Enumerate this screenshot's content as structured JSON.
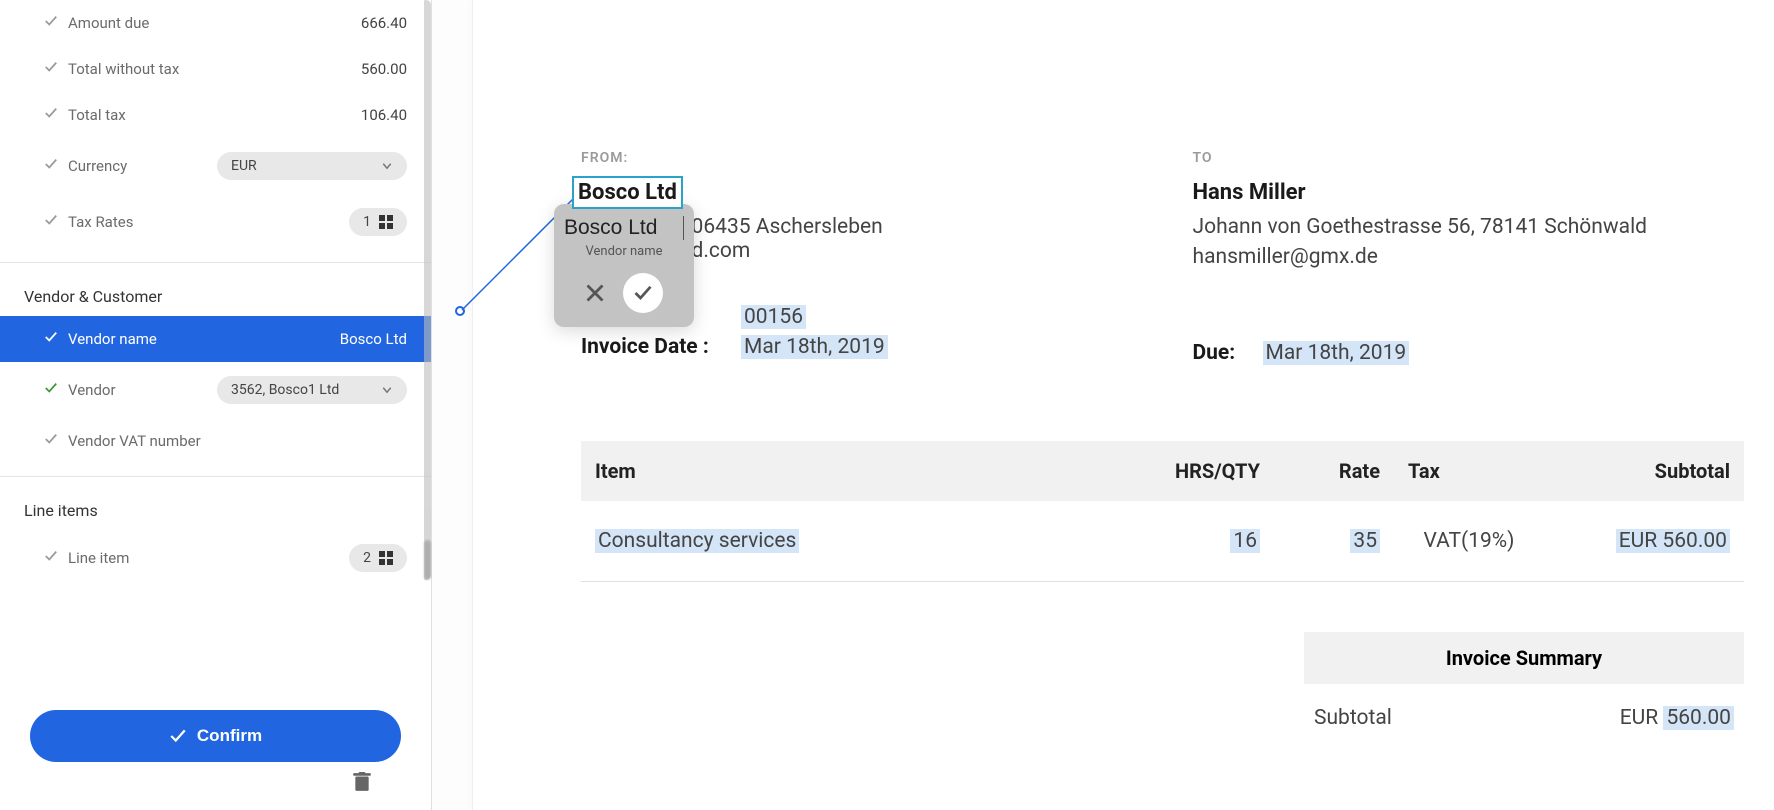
{
  "sidebar": {
    "fields": {
      "amount_due": {
        "label": "Amount due",
        "value": "666.40"
      },
      "total_without_tax": {
        "label": "Total without tax",
        "value": "560.00"
      },
      "total_tax": {
        "label": "Total tax",
        "value": "106.40"
      },
      "currency": {
        "label": "Currency",
        "value": "EUR"
      },
      "tax_rates": {
        "label": "Tax Rates",
        "count": "1"
      }
    },
    "vendor_customer": {
      "title": "Vendor & Customer",
      "vendor_name": {
        "label": "Vendor name",
        "value": "Bosco Ltd"
      },
      "vendor": {
        "label": "Vendor",
        "value": "3562, Bosco1 Ltd"
      },
      "vendor_vat": {
        "label": "Vendor VAT number"
      }
    },
    "line_items": {
      "title": "Line items",
      "item": {
        "label": "Line item",
        "count": "2"
      }
    },
    "confirm_label": "Confirm"
  },
  "popup": {
    "value": "Bosco Ltd",
    "sub": "Vendor name"
  },
  "invoice": {
    "from_label": "FROM:",
    "to_label": "TO",
    "from": {
      "name": "Bosco Ltd",
      "addr_suffix": "06435 Aschersleben",
      "email_suffix": "d.com"
    },
    "to": {
      "name": "Hans Miller",
      "addr": "Johann von Goethestrasse 56, 78141 Schönwald",
      "email": "hansmiller@gmx.de"
    },
    "invoice_no": "00156",
    "invoice_date_label": "Invoice Date :",
    "invoice_date": "Mar 18th, 2019",
    "due_label": "Due:",
    "due_date": "Mar 18th, 2019",
    "table": {
      "headers": {
        "item": "Item",
        "qty": "HRS/QTY",
        "rate": "Rate",
        "tax": "Tax",
        "subtotal": "Subtotal"
      },
      "row": {
        "item": "Consultancy services",
        "qty": "16",
        "rate": "35",
        "tax": "VAT(19%)",
        "subtotal": "EUR 560.00"
      }
    },
    "summary": {
      "title": "Invoice Summary",
      "subtotal_label": "Subtotal",
      "subtotal_value_prefix": "EUR ",
      "subtotal_value": "560.00"
    }
  }
}
